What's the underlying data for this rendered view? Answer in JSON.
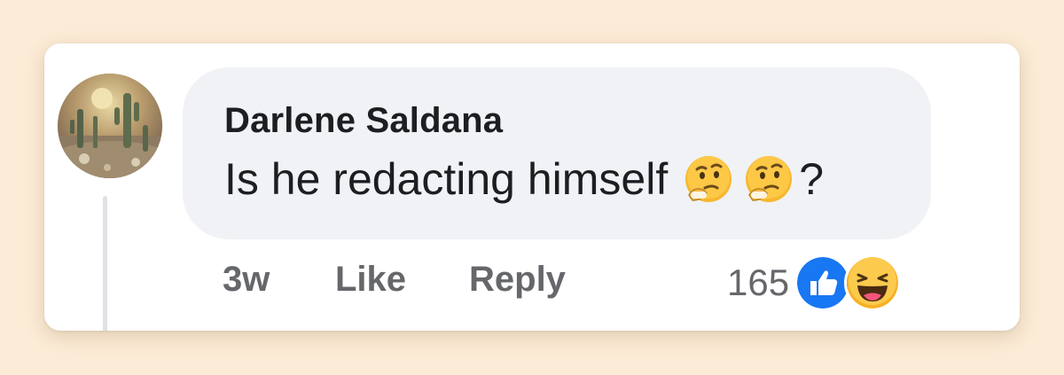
{
  "comment": {
    "author": "Darlene Saldana",
    "text": "Is he redacting himself",
    "emojis": [
      "thinking-face-icon",
      "thinking-face-icon"
    ],
    "text_suffix": "?",
    "time": "3w",
    "like_label": "Like",
    "reply_label": "Reply",
    "reaction_count": "165",
    "reactions": [
      "like-reaction-icon",
      "haha-reaction-icon"
    ]
  },
  "colors": {
    "page_background": "#fcebd6",
    "bubble": "#f0f2f5",
    "meta_text": "#65676b",
    "like_blue": "#1877f2"
  }
}
